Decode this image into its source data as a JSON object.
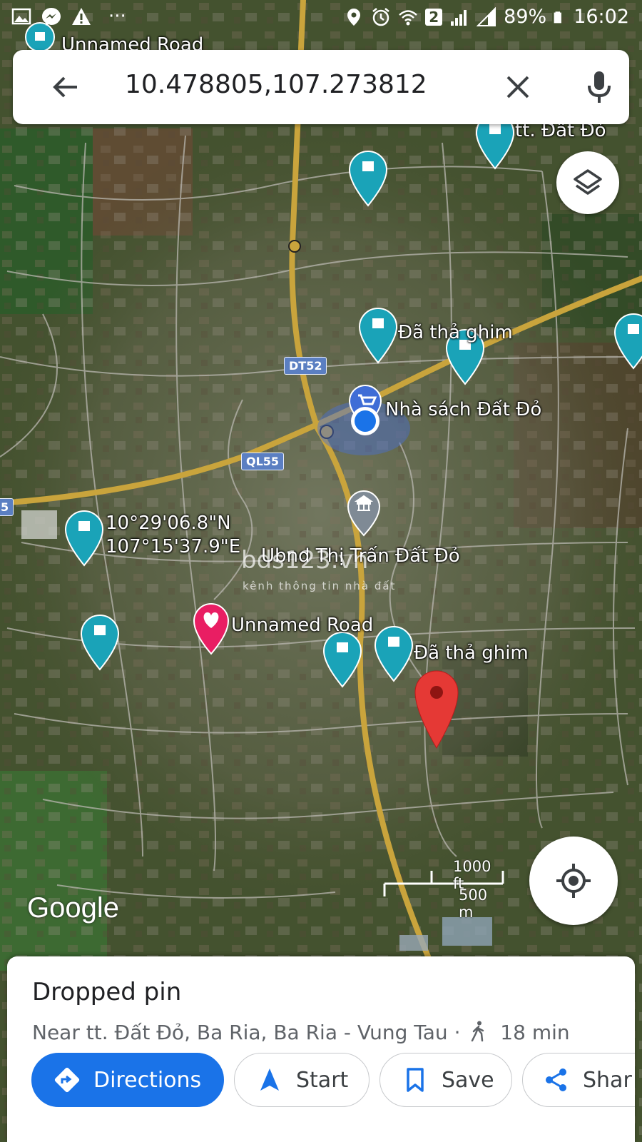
{
  "status_bar": {
    "battery": "89%",
    "time": "16:02",
    "sim_slot": "2",
    "notification_dots": "···"
  },
  "search": {
    "query": "10.478805,107.273812"
  },
  "map": {
    "labels": {
      "unnamed_road_top": "Unnamed Road",
      "tt_dat_do": "tt. Đất Đỏ",
      "da_tha_ghim_1": "Đã thả ghim",
      "nha_sach": "Nhà sách Đất Đỏ",
      "coord_lat": "10°29'06.8\"N",
      "coord_lng": "107°15'37.9\"E",
      "ubnd": "Ubnd Thị Trấn Đất Đỏ",
      "watermark": "bds123.vn",
      "watermark_sub": "kênh thông tin nhà đất",
      "unnamed_road": "Unnamed Road",
      "da_tha_ghim_2": "Đã thả ghim"
    },
    "road_shields": {
      "dt52": "DT52",
      "ql55": "QL55",
      "edge": "5"
    },
    "scale": {
      "imperial": "1000 ft",
      "metric": "500 m"
    },
    "attribution": "Google",
    "colors": {
      "pin_teal": "#1aa3b8",
      "pin_red": "#e53935",
      "pin_pink": "#e91e63",
      "pin_blue": "#1a73e8",
      "road_yellow": "#c9a43c"
    }
  },
  "place_card": {
    "title": "Dropped pin",
    "subtitle": "Near tt. Đất Đỏ, Ba Ria, Ba Ria - Vung Tau ·",
    "walk_time": "18 min",
    "actions": {
      "directions": "Directions",
      "start": "Start",
      "save": "Save",
      "share": "Shar"
    },
    "colors": {
      "primary": "#1a73e8"
    }
  }
}
